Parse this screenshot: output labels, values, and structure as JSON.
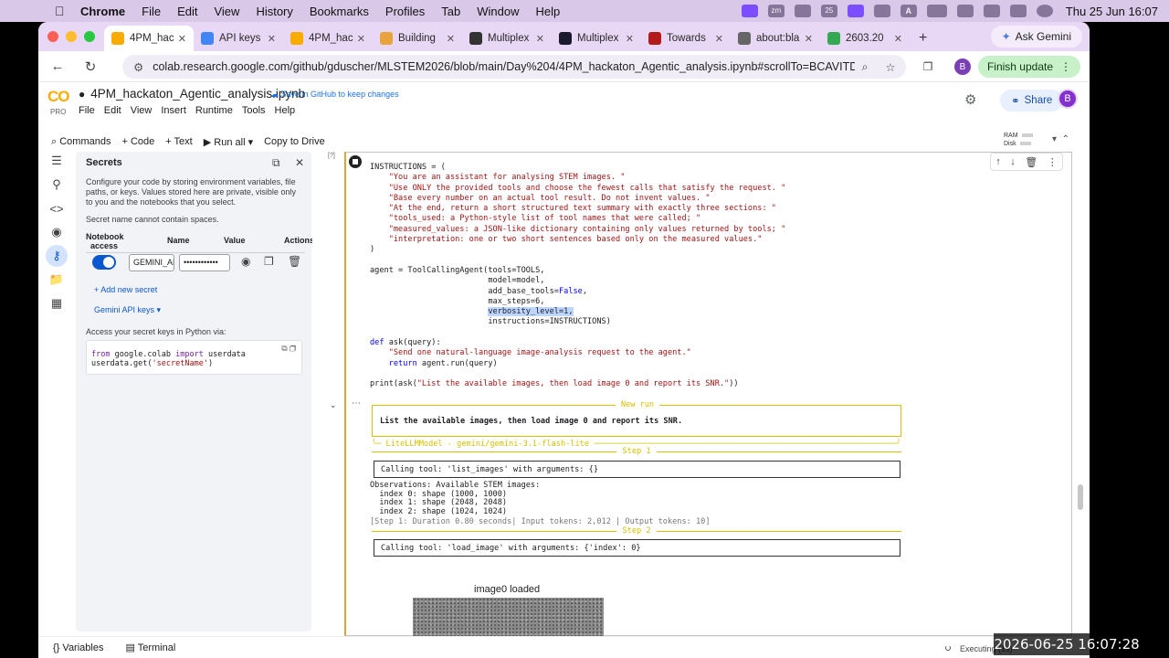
{
  "menubar": {
    "app": "Chrome",
    "items": [
      "File",
      "Edit",
      "View",
      "History",
      "Bookmarks",
      "Profiles",
      "Tab",
      "Window",
      "Help"
    ],
    "status_icons": [
      "screen-mirror-icon",
      "zoom-icon",
      "bluetooth-icon",
      "calendar-icon",
      "stage-manager-icon",
      "phone-icon",
      "input-source-icon",
      "battery-icon",
      "search-icon",
      "wifi-icon",
      "control-center-icon",
      "siri-icon"
    ],
    "input_source": "A",
    "zoom_badge": "zm",
    "calendar_badge": "25",
    "clock": "Thu 25 Jun  16:07"
  },
  "tabs": [
    {
      "title": "4PM_hac",
      "active": true,
      "icon_color": "#f9ab00"
    },
    {
      "title": "API keys",
      "active": false,
      "icon_color": "#4285f4"
    },
    {
      "title": "4PM_hac",
      "active": false,
      "icon_color": "#f9ab00"
    },
    {
      "title": "Building",
      "active": false,
      "icon_color": "#e8a33c"
    },
    {
      "title": "Multiplex",
      "active": false,
      "icon_color": "#333333"
    },
    {
      "title": "Multiplex",
      "active": false,
      "icon_color": "#1a1a2e"
    },
    {
      "title": "Towards",
      "active": false,
      "icon_color": "#b31b1b"
    },
    {
      "title": "about:bla",
      "active": false,
      "icon_color": "#666666"
    },
    {
      "title": "2603.20",
      "active": false,
      "icon_color": "#34a853"
    }
  ],
  "ask_gemini": "Ask Gemini",
  "url": "colab.research.google.com/github/gduscher/MLSTEM2026/blob/main/Day%204/4PM_hackaton_Agentic_analysis.ipynb#scrollTo=BCAVITDyhFlo",
  "finish_update": "Finish update",
  "profile_initial": "B",
  "colab": {
    "logo": "CO",
    "pro": "PRO",
    "title": "4PM_hackaton_Agentic_analysis.ipynb",
    "save_github": "Save in GitHub to keep changes",
    "menu": [
      "File",
      "Edit",
      "View",
      "Insert",
      "Runtime",
      "Tools",
      "Help"
    ],
    "share": "Share",
    "avatar": "B",
    "commands": [
      "Commands",
      "+ Code",
      "+ Text",
      "Run all",
      "Copy to Drive"
    ],
    "ram": "RAM",
    "disk": "Disk"
  },
  "secrets": {
    "title": "Secrets",
    "description": "Configure your code by storing environment variables, file paths, or keys. Values stored here are private, visible only to you and the notebooks that you select.",
    "note": "Secret name cannot contain spaces.",
    "headers": [
      "Notebook access",
      "Name",
      "Value",
      "Actions"
    ],
    "row_name": "GEMINI_API_KEY",
    "row_value": "••••••••••••",
    "add": "+ Add new secret",
    "gemini_keys": "Gemini API keys",
    "access_text": "Access your secret keys in Python via:",
    "code_line1_kw1": "from",
    "code_line1_mod": " google.colab ",
    "code_line1_kw2": "import",
    "code_line1_rest": " userdata",
    "code_line2_a": "userdata.get(",
    "code_line2_str": "'secretName'",
    "code_line2_b": ")"
  },
  "cell": {
    "exec_count": "[?]",
    "code_lines": [
      {
        "t": "INSTRUCTIONS = ("
      },
      {
        "t": "    ",
        "s": "\"You are an assistant for analysing STEM images. \""
      },
      {
        "t": "    ",
        "s": "\"Use ONLY the provided tools and choose the fewest calls that satisfy the request. \""
      },
      {
        "t": "    ",
        "s": "\"Base every number on an actual tool result. Do not invent values. \""
      },
      {
        "t": "    ",
        "s": "\"At the end, return a short structured text summary with exactly three sections: \""
      },
      {
        "t": "    ",
        "s": "\"tools_used: a Python-style list of tool names that were called; \""
      },
      {
        "t": "    ",
        "s": "\"measured_values: a JSON-like dictionary containing only values returned by tools; \""
      },
      {
        "t": "    ",
        "s": "\"interpretation: one or two short sentences based only on the measured values.\""
      },
      {
        "t": ")"
      },
      {
        "t": ""
      },
      {
        "t": "agent = ToolCallingAgent(tools=TOOLS,"
      },
      {
        "t": "                         model=model,"
      },
      {
        "t": "                         add_base_tools=",
        "k": "False",
        "e": ","
      },
      {
        "t": "                         max_steps=6,"
      },
      {
        "t": "                         ",
        "h": "verbosity_level=1,"
      },
      {
        "t": "                         instructions=INSTRUCTIONS)"
      },
      {
        "t": ""
      },
      {
        "t": "",
        "k": "def",
        "e": " ask(query):"
      },
      {
        "t": "    ",
        "s": "\"Send one natural-language image-analysis request to the agent.\""
      },
      {
        "t": "    ",
        "k": "return",
        "e": " agent.run(query)"
      },
      {
        "t": ""
      },
      {
        "t": "print(ask(",
        "s": "\"List the available images, then load image 0 and report its SNR.\"",
        "e": "))"
      }
    ]
  },
  "output": {
    "new_run": "New run",
    "query": "List the available images, then load image 0 and report its SNR.",
    "model": "LiteLLMModel - gemini/gemini-3.1-flash-lite",
    "step1": "Step 1",
    "tool1": "Calling tool: 'list_images' with arguments: {}",
    "obs": "Observations: Available STEM images:\n  index 0: shape (1000, 1000)\n  index 1: shape (2048, 2048)\n  index 2: shape (1024, 1024)",
    "stepinfo1": "[Step 1: Duration 0.80 seconds| Input tokens: 2,012 | Output tokens: 10]",
    "step2": "Step 2",
    "tool2": "Calling tool: 'load_image' with arguments: {'index': 0}",
    "image_title": "image0 loaded"
  },
  "bottom": {
    "variables": "Variables",
    "terminal": "Terminal",
    "executing": "Executing (1s)"
  },
  "timestamp": "2026-06-25 16:07:28"
}
